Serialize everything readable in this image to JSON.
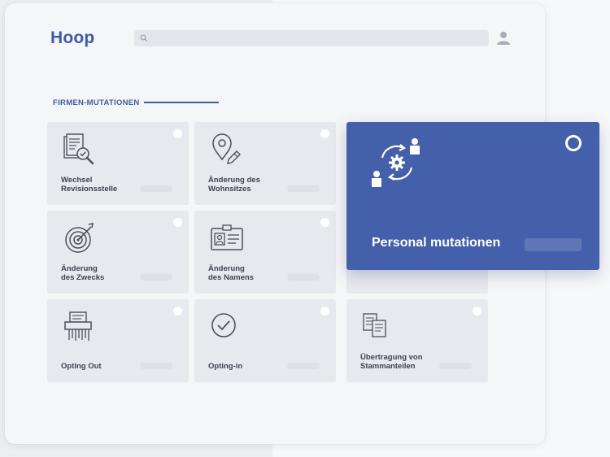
{
  "app": {
    "logo": "Hoop"
  },
  "search": {
    "placeholder": ""
  },
  "section": {
    "title": "FIRMEN-MUTATIONEN"
  },
  "cards": [
    {
      "label": "Wechsel\nRevisionsstelle",
      "icon": "document-search-icon"
    },
    {
      "label": "Änderung des\nWohnsitzes",
      "icon": "location-edit-icon"
    },
    {
      "label": "Änderung\ndes Zwecks",
      "icon": "target-icon"
    },
    {
      "label": "Änderung\ndes Namens",
      "icon": "id-card-icon"
    },
    {
      "label": "Opting Out",
      "icon": "shredder-icon"
    },
    {
      "label": "Opting-in",
      "icon": "check-circle-icon"
    },
    {
      "label": "Übertragung von\nStammanteilen",
      "icon": "documents-transfer-icon"
    }
  ],
  "featured": {
    "label": "Personal mutationen",
    "icon": "people-exchange-icon"
  },
  "colors": {
    "accent": "#3f5aa8",
    "featured_bg": "#4460ab",
    "card_bg": "#e6e9ed"
  }
}
